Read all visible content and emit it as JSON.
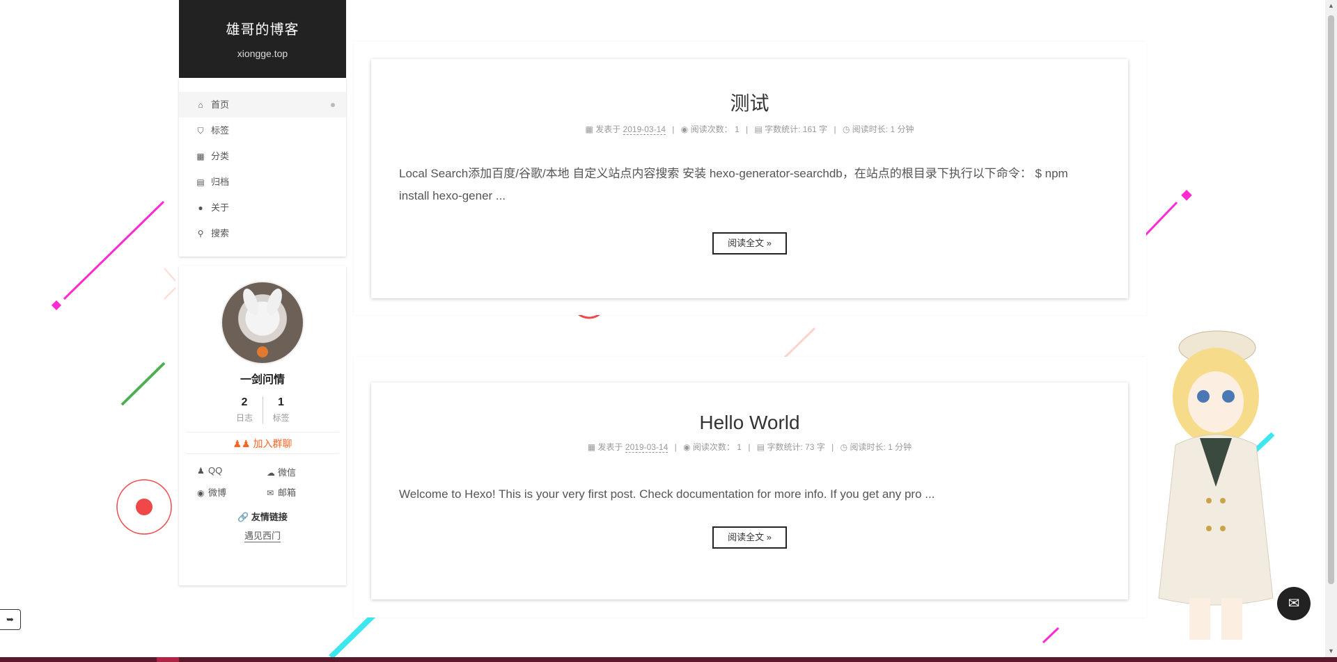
{
  "site": {
    "title": "雄哥的博客",
    "subtitle": "xiongge.top"
  },
  "menu": [
    {
      "label": "首页",
      "icon": "home-icon",
      "glyph": "⌂",
      "active": true
    },
    {
      "label": "标签",
      "icon": "tags-icon",
      "glyph": "⛉",
      "active": false
    },
    {
      "label": "分类",
      "icon": "th-icon",
      "glyph": "▦",
      "active": false
    },
    {
      "label": "归档",
      "icon": "archive-icon",
      "glyph": "▤",
      "active": false
    },
    {
      "label": "关于",
      "icon": "user-icon",
      "glyph": "●",
      "active": false
    },
    {
      "label": "搜索",
      "icon": "search-icon",
      "glyph": "⚲",
      "active": false
    }
  ],
  "profile": {
    "name": "一剑问情",
    "posts_count": "2",
    "posts_label": "日志",
    "tags_count": "1",
    "tags_label": "标签",
    "join_label": "加入群聊",
    "socials": [
      {
        "label": "QQ",
        "icon": "qq-icon",
        "glyph": "♟"
      },
      {
        "label": "微信",
        "icon": "wechat-icon",
        "glyph": "☁"
      },
      {
        "label": "微博",
        "icon": "weibo-icon",
        "glyph": "◉"
      },
      {
        "label": "邮箱",
        "icon": "mail-icon",
        "glyph": "✉"
      }
    ],
    "links_title": "友情链接",
    "friend_link": "遇见西门"
  },
  "posts": [
    {
      "title": "测试",
      "posted_label": "发表于",
      "date": "2019-03-14",
      "views_label": "阅读次数：",
      "views": "1",
      "words": "字数统计: 161 字",
      "read_time": "阅读时长: 1 分钟",
      "excerpt": "Local Search添加百度/谷歌/本地 自定义站点内容搜索 安装 hexo-generator-searchdb，在站点的根目录下执行以下命令： $ npm install hexo-gener ...",
      "read_more": "阅读全文 »"
    },
    {
      "title": "Hello World",
      "posted_label": "发表于",
      "date": "2019-03-14",
      "views_label": "阅读次数：",
      "views": "1",
      "words": "字数统计: 73 字",
      "read_time": "阅读时长: 1 分钟",
      "excerpt": "Welcome to Hexo! This is your very first post. Check documentation for more info. If you get any pro ...",
      "read_more": "阅读全文 »"
    }
  ],
  "colors": {
    "accent": "#fc6423",
    "header_bg": "#222222",
    "magenta": "#ff2bd1",
    "cyan": "#3ee6f0",
    "red": "#f04848",
    "green": "#4caf50"
  }
}
